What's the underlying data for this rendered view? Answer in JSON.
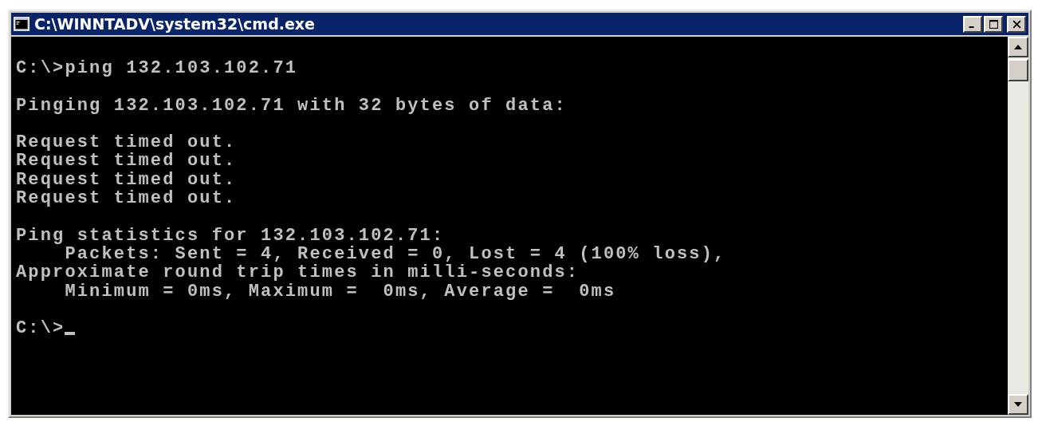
{
  "window": {
    "title": "C:\\WINNTADV\\system32\\cmd.exe"
  },
  "console": {
    "blocks": [
      [
        "C:\\>ping 132.103.102.71"
      ],
      [
        "Pinging 132.103.102.71 with 32 bytes of data:"
      ],
      [
        "Request timed out.",
        "Request timed out.",
        "Request timed out.",
        "Request timed out."
      ],
      [
        "Ping statistics for 132.103.102.71:",
        "    Packets: Sent = 4, Received = 0, Lost = 4 (100% loss),",
        "Approximate round trip times in milli-seconds:",
        "    Minimum = 0ms, Maximum =  0ms, Average =  0ms"
      ]
    ],
    "prompt": "C:\\>"
  }
}
